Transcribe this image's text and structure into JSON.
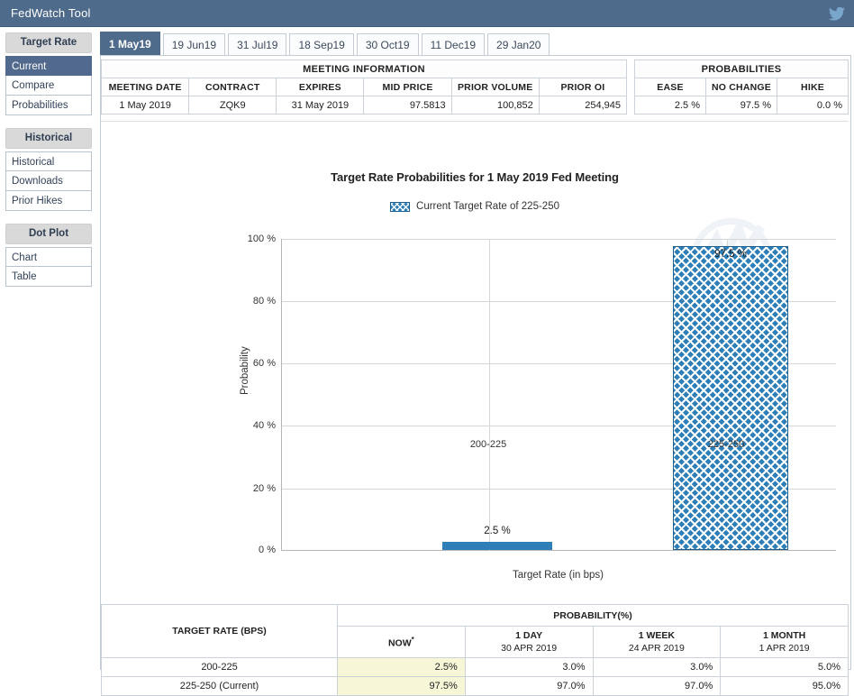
{
  "titlebar": {
    "title": "FedWatch Tool",
    "social_icon": "twitter-icon"
  },
  "sidebar": {
    "groups": [
      {
        "header": "Target Rate",
        "items": [
          {
            "label": "Current",
            "active": true
          },
          {
            "label": "Compare",
            "active": false
          },
          {
            "label": "Probabilities",
            "active": false
          }
        ]
      },
      {
        "header": "Historical",
        "items": [
          {
            "label": "Historical",
            "active": false
          },
          {
            "label": "Downloads",
            "active": false
          },
          {
            "label": "Prior Hikes",
            "active": false
          }
        ]
      },
      {
        "header": "Dot Plot",
        "items": [
          {
            "label": "Chart",
            "active": false
          },
          {
            "label": "Table",
            "active": false
          }
        ]
      }
    ]
  },
  "tabs": [
    {
      "label": "1 May19",
      "active": true
    },
    {
      "label": "19 Jun19",
      "active": false
    },
    {
      "label": "31 Jul19",
      "active": false
    },
    {
      "label": "18 Sep19",
      "active": false
    },
    {
      "label": "30 Oct19",
      "active": false
    },
    {
      "label": "11 Dec19",
      "active": false
    },
    {
      "label": "29 Jan20",
      "active": false
    }
  ],
  "meeting_information": {
    "group_header": "MEETING INFORMATION",
    "columns": [
      "MEETING DATE",
      "CONTRACT",
      "EXPIRES",
      "MID PRICE",
      "PRIOR VOLUME",
      "PRIOR OI"
    ],
    "row": {
      "meeting_date": "1 May 2019",
      "contract": "ZQK9",
      "expires": "31 May 2019",
      "mid_price": "97.5813",
      "prior_volume": "100,852",
      "prior_oi": "254,945"
    }
  },
  "probabilities_summary": {
    "group_header": "PROBABILITIES",
    "columns": [
      "EASE",
      "NO CHANGE",
      "HIKE"
    ],
    "row": {
      "ease": "2.5 %",
      "no_change": "97.5 %",
      "hike": "0.0 %"
    }
  },
  "chart_data": {
    "type": "bar",
    "title": "Target Rate Probabilities for 1 May 2019 Fed Meeting",
    "legend": [
      {
        "label": "Current Target Rate of 225-250",
        "swatch": "hatched-blue"
      }
    ],
    "legend_position": "top-center",
    "xlabel": "Target Rate (in bps)",
    "ylabel": "Probability",
    "categories": [
      "200-225",
      "225-250"
    ],
    "values": [
      2.5,
      97.5
    ],
    "data_labels": [
      "2.5 %",
      "97.5 %"
    ],
    "ylim": [
      0,
      100
    ],
    "yticks": [
      0,
      20,
      40,
      60,
      80,
      100
    ],
    "ytick_labels": [
      "0 %",
      "20 %",
      "40 %",
      "60 %",
      "80 %",
      "100 %"
    ],
    "grid": true,
    "bar_styles": [
      "solid",
      "hatched"
    ],
    "bar_color": "#2e7fb8",
    "watermark": "cme-logo-watermark"
  },
  "probability_table": {
    "target_rate_header": "TARGET RATE (BPS)",
    "probability_header": "PROBABILITY(%)",
    "period_columns": [
      {
        "name": "NOW",
        "superscript": "*",
        "date": ""
      },
      {
        "name": "1 DAY",
        "superscript": "",
        "date": "30 APR 2019"
      },
      {
        "name": "1 WEEK",
        "superscript": "",
        "date": "24 APR 2019"
      },
      {
        "name": "1 MONTH",
        "superscript": "",
        "date": "1 APR 2019"
      }
    ],
    "rows": [
      {
        "target_rate": "200-225",
        "now": "2.5%",
        "one_day": "3.0%",
        "one_week": "3.0%",
        "one_month": "5.0%"
      },
      {
        "target_rate": "225-250 (Current)",
        "now": "97.5%",
        "one_day": "97.0%",
        "one_week": "97.0%",
        "one_month": "95.0%"
      }
    ]
  },
  "colors": {
    "titlebar": "#4e6b8c",
    "sidebar_active": "#51698c",
    "bar": "#2e7fb8",
    "now_highlight": "#f7f7d8"
  }
}
